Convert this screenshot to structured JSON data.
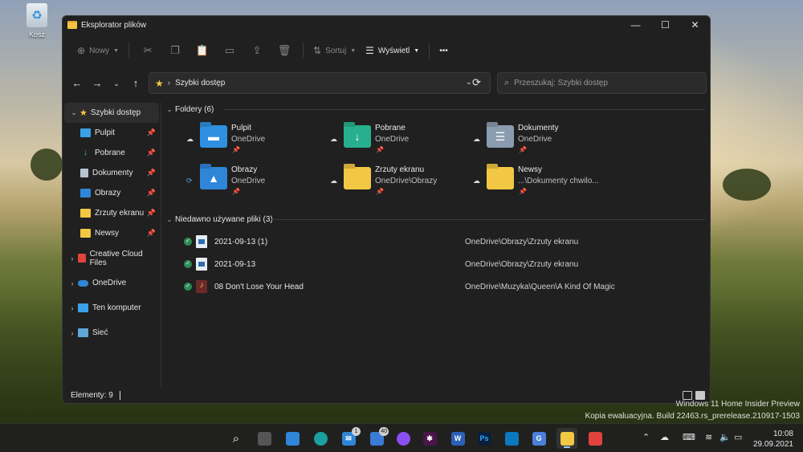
{
  "desktop": {
    "recycle_bin_label": "Kosz"
  },
  "window": {
    "title": "Eksplorator plików",
    "minimize": "—",
    "maximize": "☐",
    "close": "✕"
  },
  "toolbar": {
    "new_label": "Nowy",
    "sort_label": "Sortuj",
    "view_label": "Wyświetl",
    "more": "•••"
  },
  "address": {
    "location": "Szybki dostęp",
    "search_placeholder": "Przeszukaj: Szybki dostęp"
  },
  "sidebar": {
    "quick_access": "Szybki dostęp",
    "pinned": [
      {
        "label": "Pulpit",
        "color": "#3aa0e8"
      },
      {
        "label": "Pobrane",
        "color": "#2fbf9a"
      },
      {
        "label": "Dokumenty",
        "color": "#b8c3d1"
      },
      {
        "label": "Obrazy",
        "color": "#2f86d8"
      },
      {
        "label": "Zrzuty ekranu",
        "color": "#f2c744"
      },
      {
        "label": "Newsy",
        "color": "#f2c744"
      }
    ],
    "roots": [
      "Creative Cloud Files",
      "OneDrive",
      "Ten komputer",
      "Sieć"
    ]
  },
  "content": {
    "folders_header": "Foldery (6)",
    "folders": [
      {
        "name": "Pulpit",
        "location": "OneDrive",
        "color": "#2f8fe0",
        "icon": "monitor-icon"
      },
      {
        "name": "Pobrane",
        "location": "OneDrive",
        "color": "#27b08d",
        "icon": "download-icon"
      },
      {
        "name": "Dokumenty",
        "location": "OneDrive",
        "color": "#8b9bb0",
        "icon": "document-icon"
      },
      {
        "name": "Obrazy",
        "location": "OneDrive",
        "color": "#2f86d8",
        "icon": "image-icon"
      },
      {
        "name": "Zrzuty ekranu",
        "location": "OneDrive\\Obrazy",
        "color": "#f2c744",
        "icon": "folder-icon"
      },
      {
        "name": "Newsy",
        "location": "...\\Dokumenty chwilo...",
        "color": "#f2c744",
        "icon": "folder-icon"
      }
    ],
    "recent_header": "Niedawno używane pliki (3)",
    "recent": [
      {
        "name": "2021-09-13 (1)",
        "path": "OneDrive\\Obrazy\\Zrzuty ekranu",
        "type": "img"
      },
      {
        "name": "2021-09-13",
        "path": "OneDrive\\Obrazy\\Zrzuty ekranu",
        "type": "img"
      },
      {
        "name": "08 Don't Lose Your Head",
        "path": "OneDrive\\Muzyka\\Queen\\A Kind Of Magic",
        "type": "music"
      }
    ]
  },
  "status": {
    "items": "Elementy: 9"
  },
  "watermark": {
    "line1": "Windows 11 Home Insider Preview",
    "line2": "Kopia ewaluacyjna. Build 22463.rs_prerelease.210917-1503"
  },
  "taskbar": {
    "badges": {
      "mail": "1",
      "news": "40"
    },
    "time": "10:08",
    "date": "29.09.2021"
  }
}
